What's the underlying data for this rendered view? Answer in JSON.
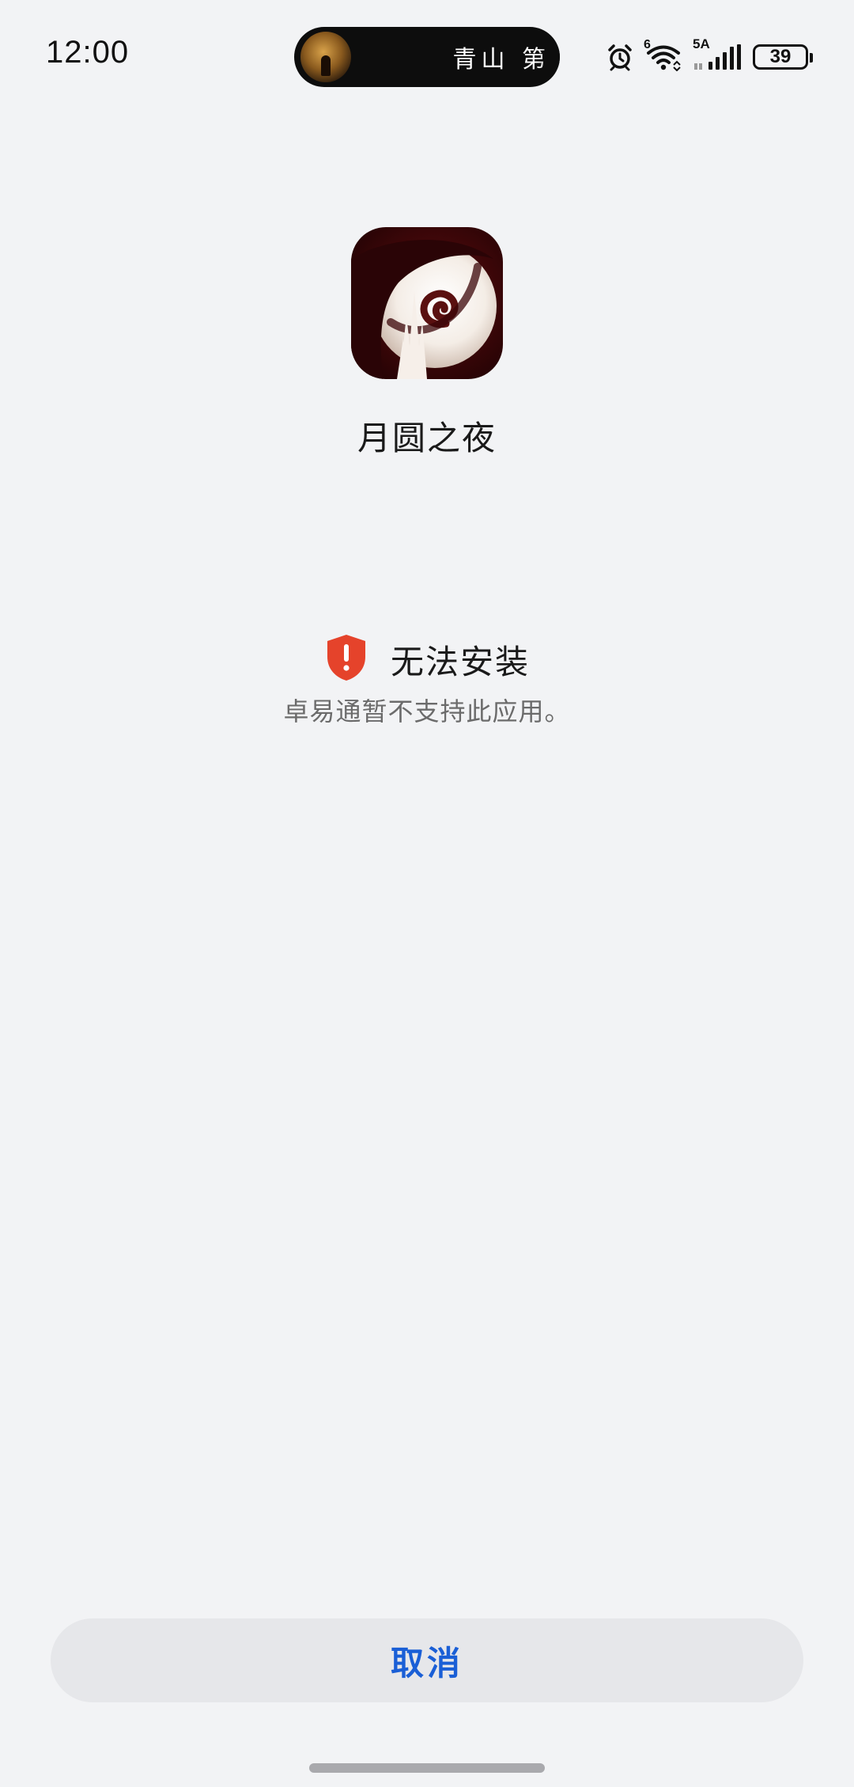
{
  "status_bar": {
    "time": "12:00",
    "live_activity_text": "青山 第",
    "network_label_top": "6",
    "signal_label": "5A",
    "battery_level": "39"
  },
  "app": {
    "name": "月圆之夜",
    "icon": "full-moon-night-app-icon"
  },
  "install": {
    "status_title": "无法安装",
    "status_icon": "shield-alert-icon",
    "status_icon_color": "#e5432b",
    "description": "卓易通暂不支持此应用。"
  },
  "actions": {
    "cancel_label": "取消",
    "cancel_color": "#1a5fd6"
  }
}
